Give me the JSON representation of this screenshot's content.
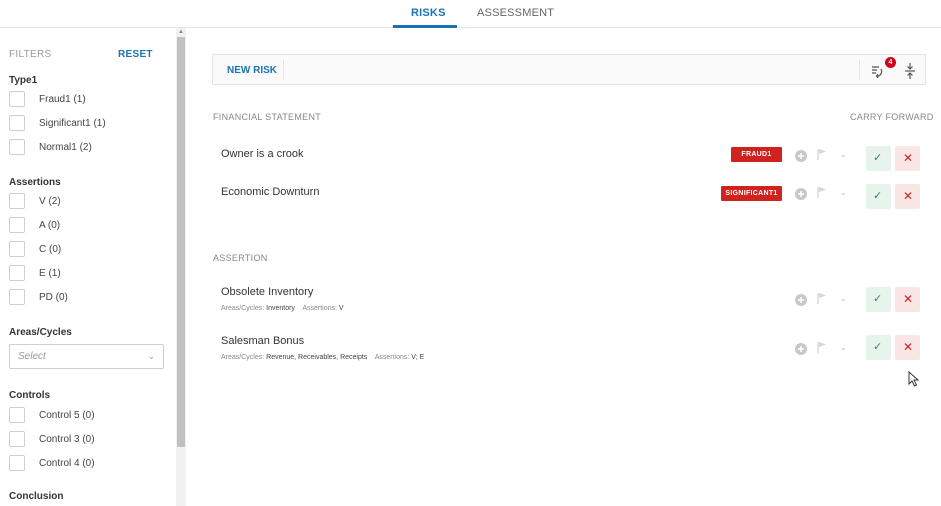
{
  "tabs": [
    {
      "label": "RISKS",
      "active": true
    },
    {
      "label": "ASSESSMENT",
      "active": false
    }
  ],
  "filters": {
    "title": "FILTERS",
    "reset_label": "RESET",
    "type_group": {
      "title": "Type1",
      "options": [
        "Fraud1 (1)",
        "Significant1 (1)",
        "Normal1 (2)"
      ]
    },
    "assertions_group": {
      "title": "Assertions",
      "options": [
        "V (2)",
        "A (0)",
        "C (0)",
        "E (1)",
        "PD (0)"
      ]
    },
    "areas_group": {
      "title": "Areas/Cycles",
      "select_placeholder": "Select"
    },
    "controls_group": {
      "title": "Controls",
      "options": [
        "Control 5 (0)",
        "Control 3 (0)",
        "Control 4 (0)"
      ]
    },
    "conclusion_group": {
      "title": "Conclusion"
    }
  },
  "toolbar": {
    "new_risk_label": "NEW RISK",
    "sync_badge_count": "4",
    "sync_icon": "sync-icon",
    "expand_icon": "expand-collapse-icon"
  },
  "sections": {
    "financial_statement": {
      "title": "FINANCIAL STATEMENT",
      "carry_forward_label": "CARRY FORWARD",
      "risks": [
        {
          "name": "Owner is a crook",
          "tag": "FRAUD1"
        },
        {
          "name": "Economic Downturn",
          "tag": "SIGNIFICANT1"
        }
      ]
    },
    "assertion": {
      "title": "ASSERTION",
      "risks": [
        {
          "name": "Obsolete Inventory",
          "areas_label": "Areas/Cycles:",
          "areas_value": "Inventory",
          "assertions_label": "Assertions:",
          "assertions_value": "V"
        },
        {
          "name": "Salesman Bonus",
          "areas_label": "Areas/Cycles:",
          "areas_value": "Revenue, Receivables, Receipts",
          "assertions_label": "Assertions:",
          "assertions_value": "V; E"
        }
      ]
    }
  },
  "colors": {
    "accent": "#1a73b5",
    "tag_red": "#d0231f",
    "accept_bg": "#e7f4ec",
    "reject_bg": "#fbe6e6"
  }
}
